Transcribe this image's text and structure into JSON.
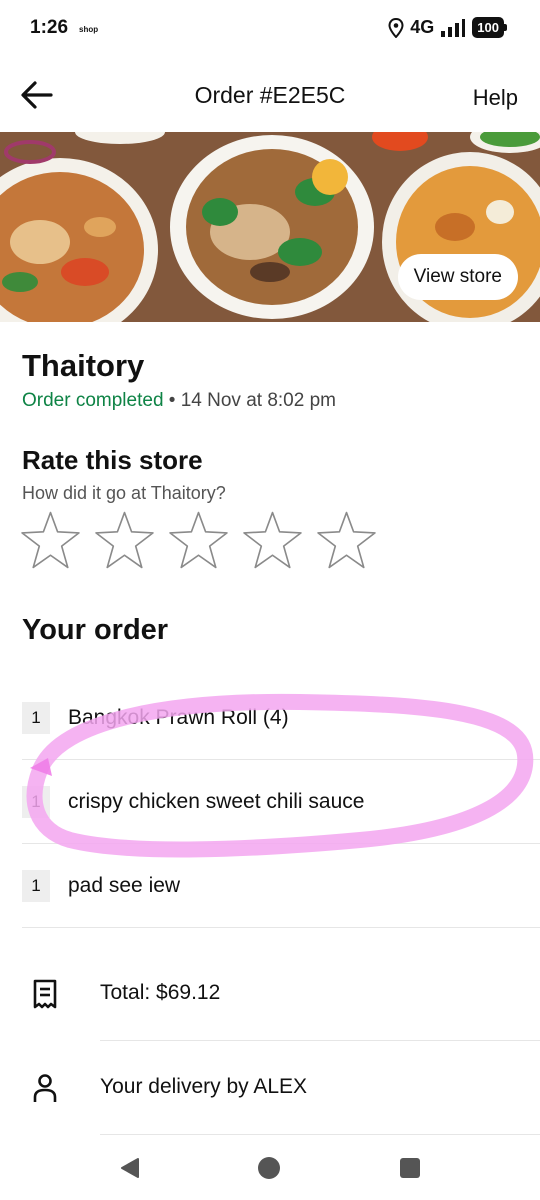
{
  "status_bar": {
    "time": "1:26",
    "shop_label": "shop",
    "network": "4G",
    "battery": "100"
  },
  "header": {
    "title": "Order #E2E5C",
    "help_label": "Help",
    "back_icon": "arrow-left-icon"
  },
  "hero": {
    "view_store_label": "View store"
  },
  "store": {
    "name": "Thaitory",
    "status": "Order completed",
    "separator": " • ",
    "datetime": "14 Nov at 8:02 pm",
    "status_color": "#0e8345"
  },
  "rating": {
    "title": "Rate this store",
    "prompt": "How did it go at Thaitory?",
    "max_stars": 5,
    "selected": 0
  },
  "order": {
    "heading": "Your order",
    "items": [
      {
        "qty": "1",
        "name": "Bangkok Prawn Roll (4)"
      },
      {
        "qty": "1",
        "name": "crispy chicken sweet chili sauce"
      },
      {
        "qty": "1",
        "name": "pad see iew"
      }
    ]
  },
  "summary": {
    "total": "Total: $69.12",
    "delivery": "Your delivery by ALEX",
    "total_icon": "receipt-icon",
    "delivery_icon": "person-icon"
  },
  "annotation": {
    "color": "#f3a6f0"
  },
  "nav": {
    "back_icon": "triangle-back-icon",
    "home_icon": "circle-home-icon",
    "recents_icon": "square-recents-icon"
  }
}
